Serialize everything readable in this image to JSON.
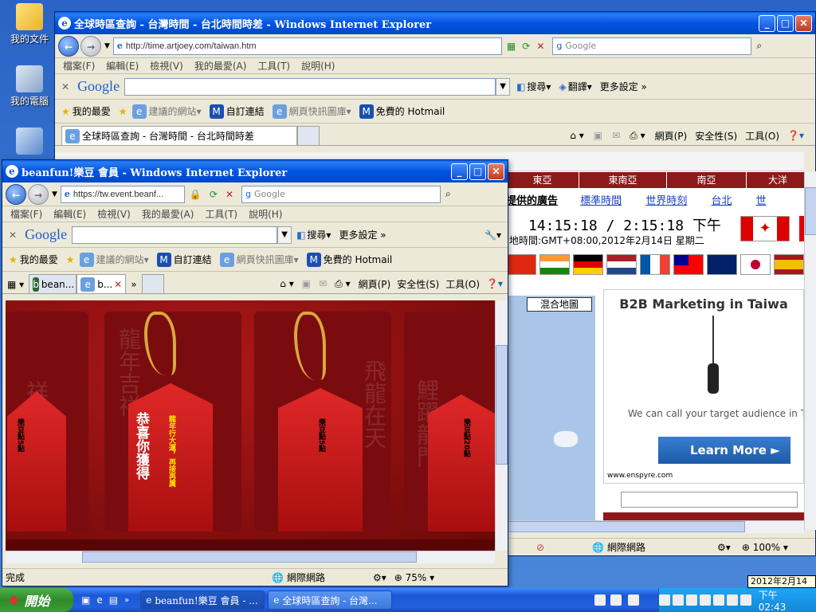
{
  "desktop": {
    "icons": [
      {
        "label": "我的文件",
        "icon": "folder-icon"
      },
      {
        "label": "我的電腦",
        "icon": "computer-icon"
      },
      {
        "label": "",
        "icon": "network-icon"
      }
    ]
  },
  "back_window": {
    "title": "全球時區查詢 - 台灣時間 - 台北時間時差 - Windows Internet Explorer",
    "address": "http://time.artjoey.com/taiwan.htm",
    "search_placeholder": "Google",
    "menu": [
      "檔案(F)",
      "編輯(E)",
      "檢視(V)",
      "我的最愛(A)",
      "工具(T)",
      "說明(H)"
    ],
    "google_bar": {
      "logo": "Google",
      "search_label": "搜尋",
      "translate_label": "翻譯",
      "settings_label": "更多設定 »"
    },
    "favorites": {
      "label": "我的最愛",
      "items": [
        "建議的網站",
        "自訂連結",
        "網頁快訊圖庫",
        "免費的 Hotmail"
      ]
    },
    "tab_label": "全球時區查詢 - 台灣時間 - 台北時間時差",
    "command_bar": [
      "網頁(P)",
      "安全性(S)",
      "工具(O)"
    ],
    "page": {
      "regions": [
        "東亞",
        "東南亞",
        "南亞",
        "大洋"
      ],
      "ad_label": "提供的廣告",
      "links": [
        "標準時間",
        "世界時刻",
        "台北",
        "世"
      ],
      "time_display": "14:15:18 / 2:15:18 下午",
      "local_time": "地時間:GMT+08:00,2012年2月14日 星期二",
      "map_button": "混合地圖",
      "ad": {
        "title": "B2B Marketing in Taiwa",
        "body": "We can call your target audience in Taiw",
        "button": "Learn More",
        "url": "www.enspyre.com"
      }
    },
    "status": {
      "zone": "網際網路",
      "zoom": "100%"
    }
  },
  "front_window": {
    "title": "beanfun!樂豆 會員 - Windows Internet Explorer",
    "address": "https://tw.event.beanf...",
    "search_placeholder": "Google",
    "menu": [
      "檔案(F)",
      "編輯(E)",
      "檢視(V)",
      "我的最愛(A)",
      "工具(T)",
      "說明(H)"
    ],
    "google_bar": {
      "logo": "Google",
      "search_label": "搜尋",
      "settings_label": "更多設定 »"
    },
    "favorites": {
      "label": "我的最愛",
      "items": [
        "建議的網站",
        "自訂連結",
        "網頁快訊圖庫",
        "免費的 Hotmail"
      ]
    },
    "tabs": [
      "bean...",
      "b..."
    ],
    "command_bar": [
      "網頁(P)",
      "安全性(S)",
      "工具(O)"
    ],
    "page": {
      "cards": [
        {
          "big": "",
          "small": "樂豆點5點",
          "bg_text": "祥龍瑞氣"
        },
        {
          "big": "恭喜你獲得",
          "small": "龍年行大運，再接再厲",
          "bg_text": "龍年吉祥"
        },
        {
          "big": "",
          "small": "樂豆點5點",
          "bg_text": "飛龍在天"
        },
        {
          "big": "",
          "small": "樂豆點20點",
          "bg_text": "鯉躍龍門"
        }
      ]
    },
    "status": {
      "text": "完成",
      "zone": "網際網路",
      "zoom": "75%"
    }
  },
  "taskbar": {
    "start_label": "開始",
    "tasks": [
      "beanfun!樂豆 會員 - ...",
      "全球時區查詢 - 台灣..."
    ],
    "clock": "下午 02:43",
    "date_tooltip": "2012年2月14日"
  }
}
